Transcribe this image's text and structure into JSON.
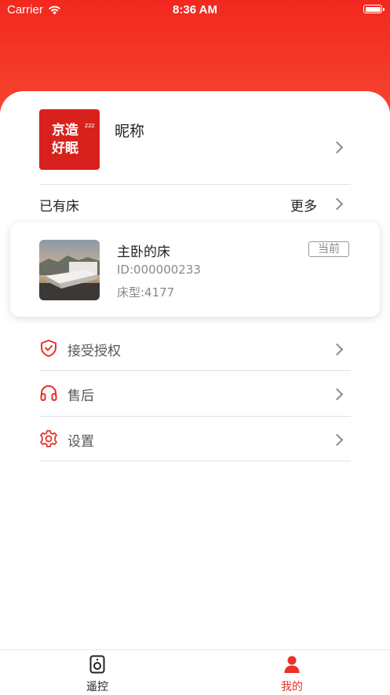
{
  "status_bar": {
    "carrier": "Carrier",
    "time": "8:36 AM"
  },
  "colors": {
    "accent": "#f2281e",
    "brand_red": "#d8211d",
    "inactive_text": "#333333"
  },
  "profile": {
    "logo_line1": "京造",
    "logo_line2": "好眠",
    "logo_zz": "zzz",
    "nickname": "昵称"
  },
  "beds_section": {
    "title": "已有床",
    "more_label": "更多"
  },
  "bed_card": {
    "name": "主卧的床",
    "id_text": "ID:000000233",
    "model_text": "床型:4177",
    "badge": "当前"
  },
  "menu": [
    {
      "label": "接受授权",
      "icon": "shield-check-icon"
    },
    {
      "label": "售后",
      "icon": "headphones-icon"
    },
    {
      "label": "设置",
      "icon": "gear-icon"
    }
  ],
  "tabbar": [
    {
      "label": "遥控",
      "icon": "remote-speaker-icon",
      "active": false
    },
    {
      "label": "我的",
      "icon": "person-icon",
      "active": true
    }
  ]
}
